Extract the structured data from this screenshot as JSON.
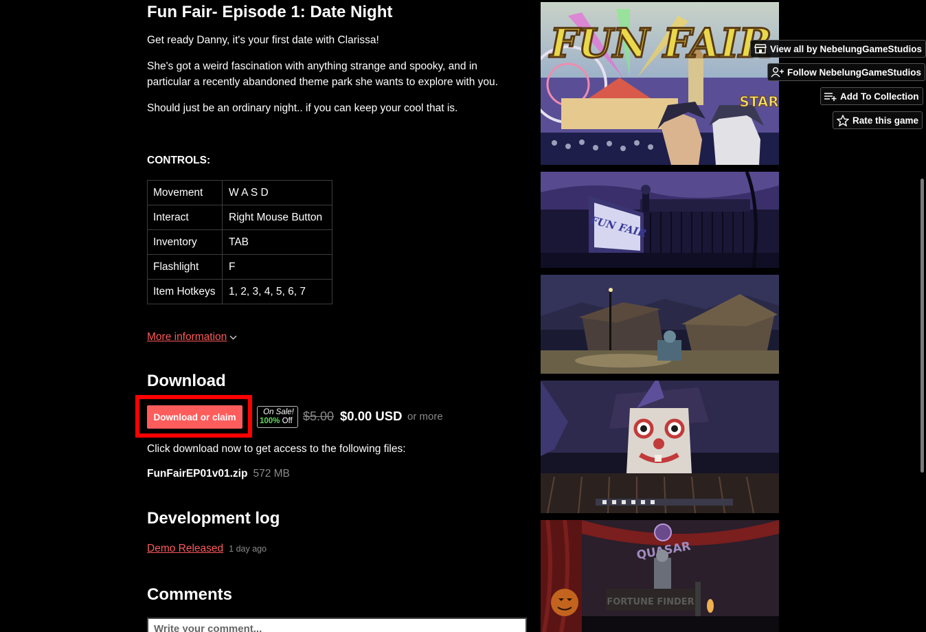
{
  "game": {
    "title": "Fun Fair- Episode 1: Date Night",
    "description": [
      "Get ready Danny, it's your first date with Clarissa!",
      "She's got a weird fascination with anything strange and spooky, and in particular a recently abandoned theme park she wants to explore with you.",
      "Should just be an ordinary night.. if you can keep your cool that is."
    ]
  },
  "controls": {
    "heading": "CONTROLS:",
    "rows": [
      {
        "action": "Movement",
        "key": "W A S D"
      },
      {
        "action": "Interact",
        "key": "Right Mouse Button"
      },
      {
        "action": "Inventory",
        "key": "TAB"
      },
      {
        "action": "Flashlight",
        "key": "F"
      },
      {
        "action": "Item Hotkeys",
        "key": "1, 2, 3, 4, 5, 6, 7"
      }
    ]
  },
  "more_info": {
    "label": "More information",
    "chevron": "chevron-down-icon"
  },
  "download": {
    "heading": "Download",
    "button_label": "Download or claim",
    "sale_badge": {
      "line1": "On Sale!",
      "percent": "100%",
      "suffix": " Off"
    },
    "old_price": "$5.00",
    "new_price": "$0.00 USD",
    "or_more": "or more",
    "files_intro": "Click download now to get access to the following files:",
    "files": [
      {
        "name": "FunFairEP01v01.zip",
        "size": "572 MB"
      }
    ]
  },
  "devlog": {
    "heading": "Development log",
    "posts": [
      {
        "title": "Demo Released",
        "date": "1 day ago"
      }
    ]
  },
  "comments": {
    "heading": "Comments",
    "placeholder": "Write your comment..."
  },
  "user_tools": {
    "view_all": "View all by NebelungGameStudios",
    "follow": "Follow NebelungGameStudios",
    "add_collection": "Add To Collection",
    "rate": "Rate this game"
  },
  "screenshots": {
    "cover_logo_text": "FUN FAIR",
    "cover_sign_text": "STAR",
    "gate_sign_text": "FUN FAIR",
    "stage_logo_text": "QUASAR",
    "stage_sign_text": "FORTUNE FINDER"
  },
  "colors": {
    "background": "#000000",
    "link": "#ff5a5a",
    "button": "#ff5c5c",
    "highlight": "#ff0000",
    "sale_green": "#5ddc5d",
    "muted": "#8a8a8a"
  }
}
